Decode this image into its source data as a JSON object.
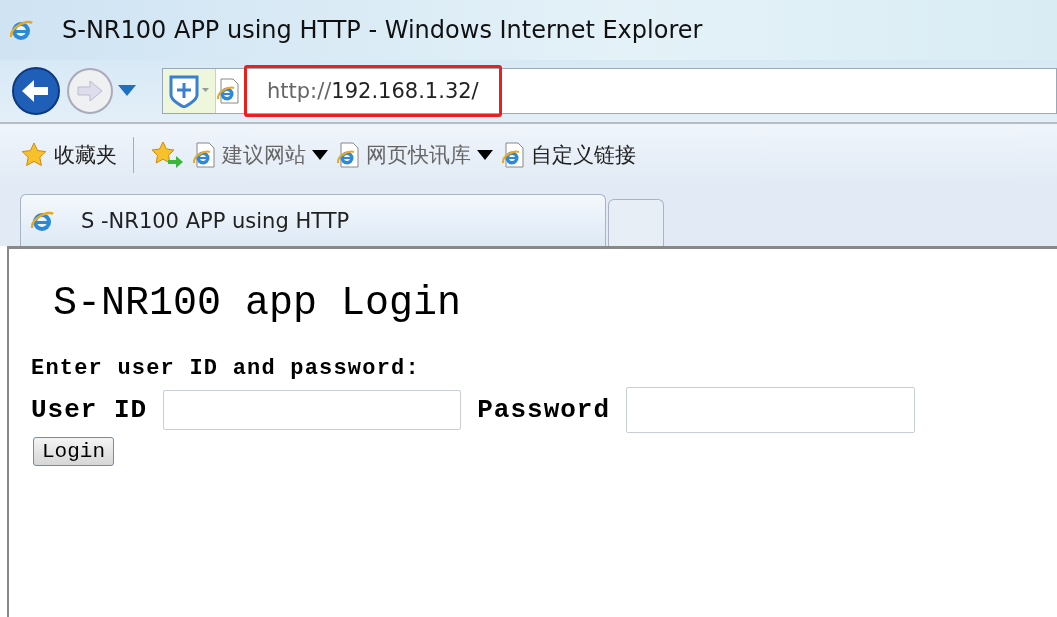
{
  "window": {
    "title": "S-NR100 APP using HTTP - Windows Internet Explorer"
  },
  "address_bar": {
    "url_scheme": "http://",
    "url_host": "192.168.1.32/",
    "highlighted": true
  },
  "favorites_bar": {
    "items": [
      {
        "kind": "favorites",
        "label": "收藏夹"
      },
      {
        "kind": "add"
      },
      {
        "kind": "link",
        "label": "建议网站",
        "dropdown": true
      },
      {
        "kind": "link",
        "label": "网页快讯库",
        "dropdown": true
      },
      {
        "kind": "link",
        "label": "自定义链接",
        "dropdown": false
      }
    ]
  },
  "tabs": [
    {
      "label": "S -NR100 APP using HTTP",
      "selected": true
    }
  ],
  "page": {
    "heading": "S-NR100 app Login",
    "instruction": "Enter user ID and password:",
    "fields": [
      {
        "label": "User ID",
        "kind": "text"
      },
      {
        "label": "Password",
        "kind": "password"
      }
    ],
    "button": "Login"
  }
}
